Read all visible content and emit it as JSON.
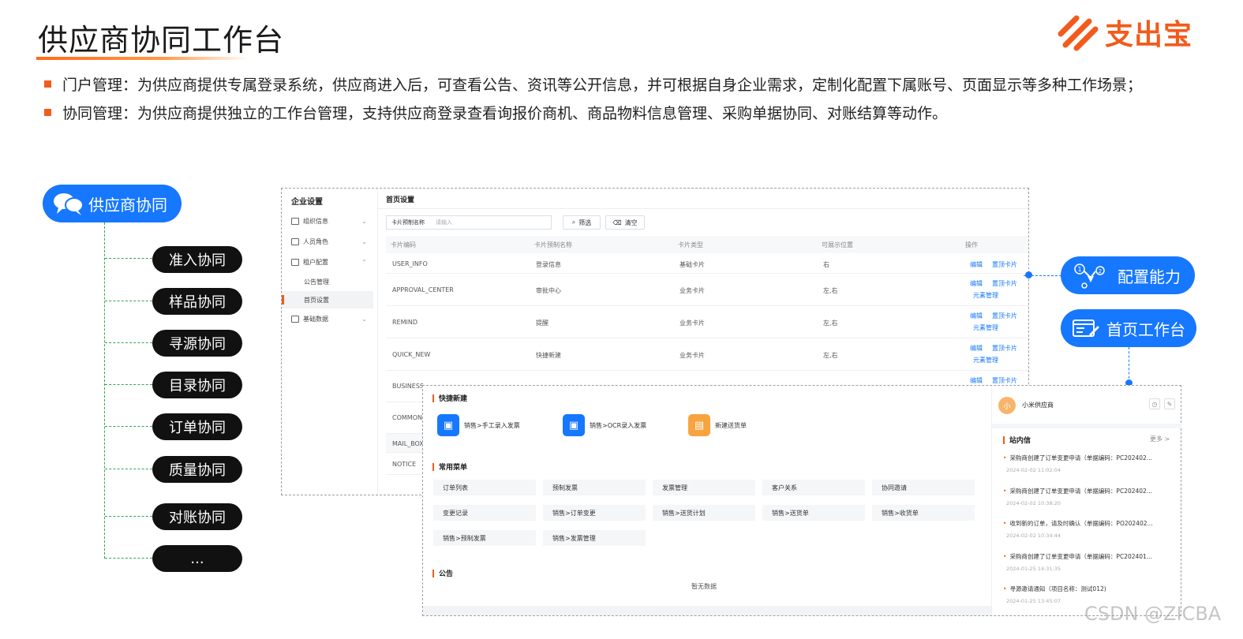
{
  "header": {
    "title": "供应商协同工作台",
    "brand_name": "支出宝",
    "brand_color": "#f25b1c"
  },
  "bullets": [
    "门户管理：为供应商提供专属登录系统，供应商进入后，可查看公告、资讯等公开信息，并可根据自身企业需求，定制化配置下属账号、页面显示等多种工作场景；",
    "协同管理：为供应商提供独立的工作台管理，支持供应商登录查看询报价商机、商品物料信息管理、采购单据协同、对账结算等动作。"
  ],
  "tree": {
    "root": "供应商协同",
    "items": [
      "准入协同",
      "样品协同",
      "寻源协同",
      "目录协同",
      "订单协同",
      "质量协同",
      "对账协同",
      "..."
    ]
  },
  "settings_screen": {
    "sidebar_title": "企业设置",
    "menu": [
      {
        "label": "组织信息",
        "icon": "org-icon"
      },
      {
        "label": "人员角色",
        "icon": "people-icon"
      },
      {
        "label": "租户配置",
        "icon": "tenant-icon"
      },
      {
        "label": "基础数据",
        "icon": "data-icon"
      }
    ],
    "submenu": [
      "公告管理",
      "首页设置"
    ],
    "page_title": "首页设置",
    "filter_label": "卡片预制名称",
    "filter_placeholder": "请输入",
    "filter_button": "筛选",
    "clear_button": "清空",
    "columns": [
      "卡片编码",
      "卡片预制名称",
      "卡片类型",
      "可展示位置",
      "操作"
    ],
    "rows": [
      {
        "code": "USER_INFO",
        "name": "登录信息",
        "type": "基础卡片",
        "pos": "右",
        "ops": [
          "编辑",
          "置顶卡片"
        ]
      },
      {
        "code": "APPROVAL_CENTER",
        "name": "审批中心",
        "type": "业务卡片",
        "pos": "左,右",
        "ops": [
          "编辑",
          "置顶卡片",
          "元素管理"
        ]
      },
      {
        "code": "REMIND",
        "name": "提醒",
        "type": "业务卡片",
        "pos": "左,右",
        "ops": [
          "编辑",
          "置顶卡片",
          "元素管理"
        ]
      },
      {
        "code": "QUICK_NEW",
        "name": "快捷新建",
        "type": "业务卡片",
        "pos": "左,右",
        "ops": [
          "编辑",
          "置顶卡片",
          "元素管理"
        ]
      },
      {
        "code": "BUSINESS",
        "name": "",
        "type": "",
        "pos": "",
        "ops": [
          "编辑",
          "置顶卡片"
        ]
      },
      {
        "code": "COMMON",
        "name": "",
        "type": "",
        "pos": "",
        "ops": []
      },
      {
        "code": "MAIL_BOX",
        "name": "",
        "type": "",
        "pos": "",
        "ops": []
      },
      {
        "code": "NOTICE",
        "name": "",
        "type": "",
        "pos": "",
        "ops": []
      }
    ]
  },
  "workbench_screen": {
    "quick_title": "快捷新建",
    "quick_items": [
      {
        "label": "销售>手工录入发票",
        "color": "#1677ff"
      },
      {
        "label": "销售>OCR录入发票",
        "color": "#1677ff"
      },
      {
        "label": "新建送货单",
        "color": "#f7a440"
      }
    ],
    "menu_title": "常用菜单",
    "menu_items": [
      "订单列表",
      "预制发票",
      "发票管理",
      "客户关系",
      "协同邀请",
      "变更记录",
      "销售>订单变更",
      "销售>送货计划",
      "销售>送货单",
      "销售>收货单",
      "销售>预制发票",
      "销售>发票管理"
    ],
    "notice_title": "公告",
    "notice_empty": "暂无数据",
    "avatar_text": "小",
    "user_name": "小米供应商",
    "inbox_title": "站内信",
    "inbox_more": "更多 >",
    "messages": [
      {
        "text": "采购商创建了订单变更申请（单据编码：PC202402...",
        "time": "2024-02-02 11:02:04"
      },
      {
        "text": "采购商创建了订单变更申请（单据编码：PC202402...",
        "time": "2024-02-02 10:38:20"
      },
      {
        "text": "收到新的订单，请及时确认（单据编码：PO202402...",
        "time": "2024-02-02 10:34:44"
      },
      {
        "text": "采购商创建了订单变更申请（单据编码：PC202401...",
        "time": "2024-01-25 14:31:35"
      },
      {
        "text": "寻源邀请通知（项目名称：测试012)",
        "time": "2024-01-25 13:45:07"
      }
    ]
  },
  "callouts": {
    "config": "配置能力",
    "home": "首页工作台"
  },
  "watermark": "CSDN @ZICBA"
}
